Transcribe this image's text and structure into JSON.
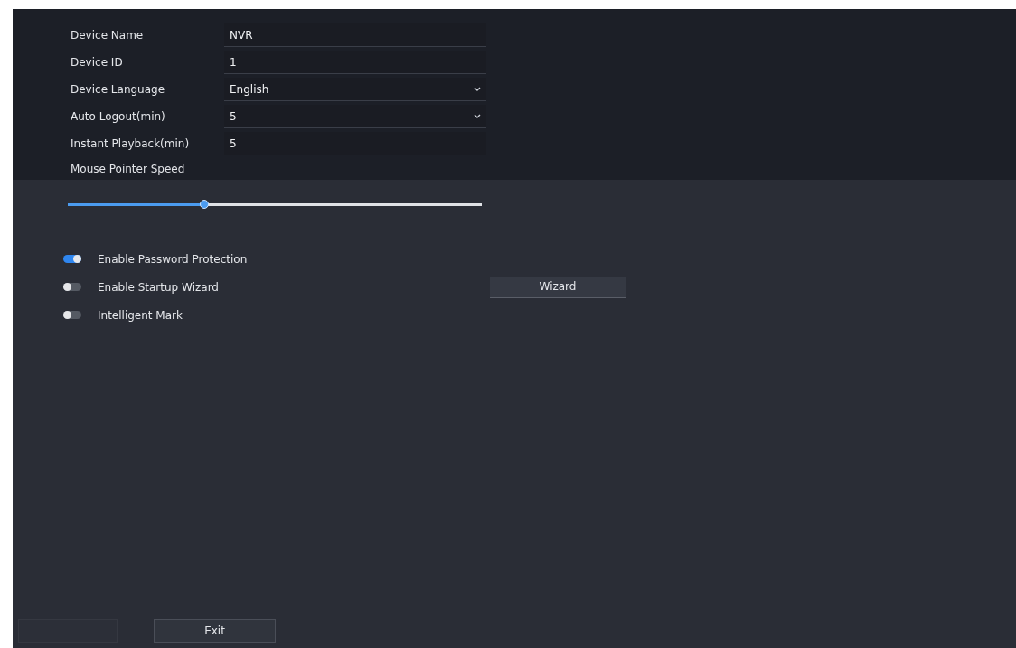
{
  "fields": [
    {
      "label": "Device Name",
      "kind": "text",
      "value": "NVR"
    },
    {
      "label": "Device ID",
      "kind": "text",
      "value": "1"
    },
    {
      "label": "Device Language",
      "kind": "select",
      "value": "English"
    },
    {
      "label": "Auto Logout(min)",
      "kind": "select",
      "value": "5"
    },
    {
      "label": "Instant Playback(min)",
      "kind": "text",
      "value": "5"
    }
  ],
  "mouse_speed": {
    "label": "Mouse Pointer Speed",
    "level": 0.33
  },
  "toggles": [
    {
      "label": "Enable Password Protection",
      "on": true
    },
    {
      "label": "Enable Startup Wizard",
      "on": false
    },
    {
      "label": "Intelligent Mark",
      "on": false
    }
  ],
  "wizard_button": "Wizard",
  "footer": {
    "apply_disabled": true,
    "exit": "Exit"
  }
}
